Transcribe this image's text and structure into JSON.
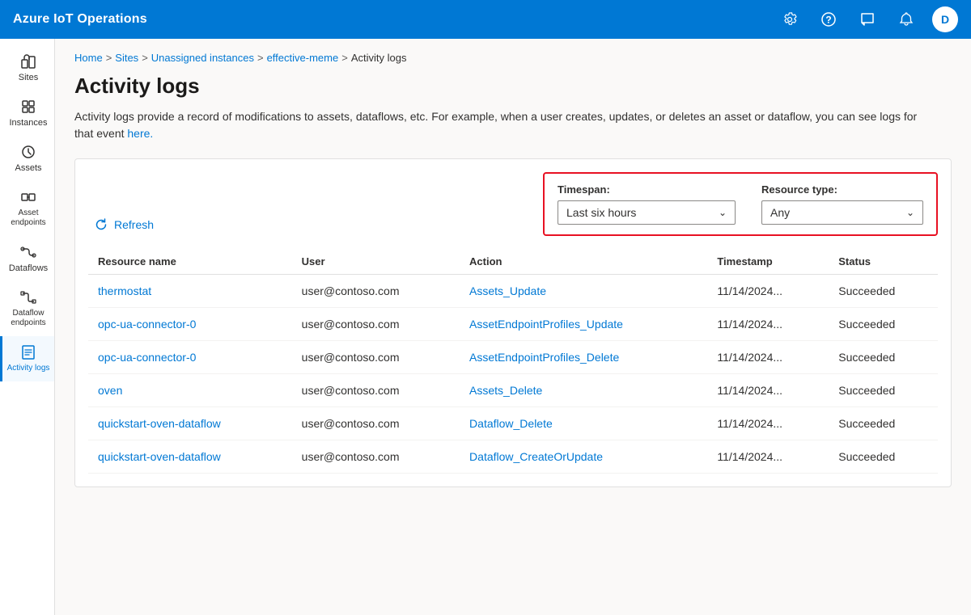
{
  "app": {
    "brand": "Azure IoT Operations",
    "avatar_letter": "D"
  },
  "topnav": {
    "icons": [
      {
        "name": "settings-icon",
        "symbol": "⚙"
      },
      {
        "name": "help-icon",
        "symbol": "?"
      },
      {
        "name": "feedback-icon",
        "symbol": "🔔"
      },
      {
        "name": "notification-icon",
        "symbol": "🔔"
      }
    ]
  },
  "sidebar": {
    "items": [
      {
        "id": "sites",
        "label": "Sites",
        "active": false
      },
      {
        "id": "instances",
        "label": "Instances",
        "active": false
      },
      {
        "id": "assets",
        "label": "Assets",
        "active": false
      },
      {
        "id": "asset-endpoints",
        "label": "Asset endpoints",
        "active": false
      },
      {
        "id": "dataflows",
        "label": "Dataflows",
        "active": false
      },
      {
        "id": "dataflow-endpoints",
        "label": "Dataflow endpoints",
        "active": false
      },
      {
        "id": "activity-logs",
        "label": "Activity logs",
        "active": true
      }
    ]
  },
  "breadcrumb": {
    "items": [
      {
        "label": "Home",
        "href": true
      },
      {
        "label": "Sites",
        "href": true
      },
      {
        "label": "Unassigned instances",
        "href": true
      },
      {
        "label": "effective-meme",
        "href": true
      },
      {
        "label": "Activity logs",
        "href": false
      }
    ]
  },
  "page": {
    "title": "Activity logs",
    "description_text": "Activity logs provide a record of modifications to assets, dataflows, etc. For example, when a user creates, updates, or deletes an asset or dataflow, you can see logs for that event",
    "description_link": "here.",
    "refresh_label": "Refresh",
    "filter": {
      "timespan_label": "Timespan:",
      "timespan_value": "Last six hours",
      "resource_type_label": "Resource type:",
      "resource_type_value": "Any"
    },
    "table": {
      "columns": [
        {
          "key": "resource_name",
          "label": "Resource name"
        },
        {
          "key": "user",
          "label": "User"
        },
        {
          "key": "action",
          "label": "Action"
        },
        {
          "key": "timestamp",
          "label": "Timestamp"
        },
        {
          "key": "status",
          "label": "Status"
        }
      ],
      "rows": [
        {
          "resource_name": "thermostat",
          "user": "user@contoso.com",
          "action": "Assets_Update",
          "timestamp": "11/14/2024...",
          "status": "Succeeded"
        },
        {
          "resource_name": "opc-ua-connector-0",
          "user": "user@contoso.com",
          "action": "AssetEndpointProfiles_Update",
          "timestamp": "11/14/2024...",
          "status": "Succeeded"
        },
        {
          "resource_name": "opc-ua-connector-0",
          "user": "user@contoso.com",
          "action": "AssetEndpointProfiles_Delete",
          "timestamp": "11/14/2024...",
          "status": "Succeeded"
        },
        {
          "resource_name": "oven",
          "user": "user@contoso.com",
          "action": "Assets_Delete",
          "timestamp": "11/14/2024...",
          "status": "Succeeded"
        },
        {
          "resource_name": "quickstart-oven-dataflow",
          "user": "user@contoso.com",
          "action": "Dataflow_Delete",
          "timestamp": "11/14/2024...",
          "status": "Succeeded"
        },
        {
          "resource_name": "quickstart-oven-dataflow",
          "user": "user@contoso.com",
          "action": "Dataflow_CreateOrUpdate",
          "timestamp": "11/14/2024...",
          "status": "Succeeded"
        }
      ]
    }
  }
}
